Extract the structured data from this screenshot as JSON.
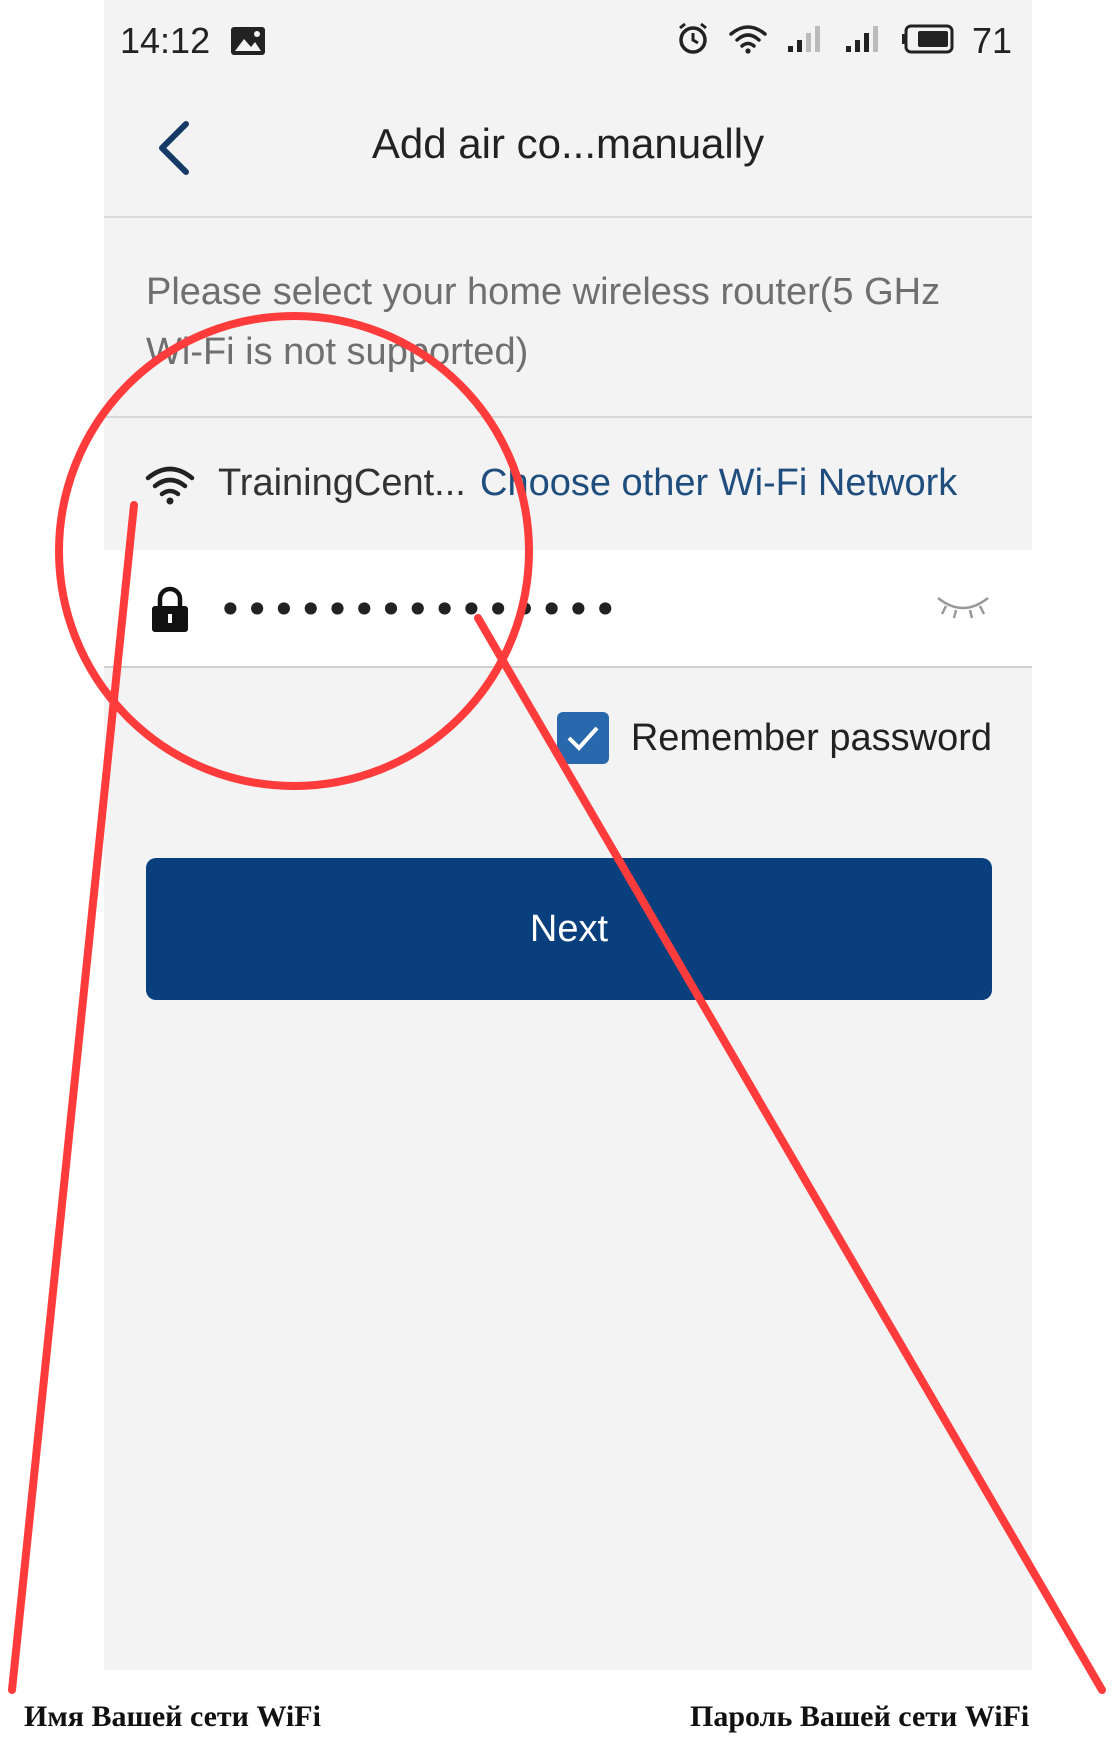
{
  "status_bar": {
    "time": "14:12",
    "battery": "71",
    "icons": [
      "image-icon",
      "alarm-icon",
      "wifi-icon",
      "signal-icon",
      "signal-icon",
      "battery-icon"
    ]
  },
  "header": {
    "back_icon": "chevron-left-icon",
    "title": "Add air co...manually"
  },
  "instruction": "Please select your home wireless router(5 GHz Wi-Fi is not supported)",
  "wifi": {
    "icon": "wifi-icon",
    "ssid": "TrainingCent...",
    "choose_label": "Choose other Wi-Fi Network"
  },
  "password": {
    "icon": "lock-icon",
    "value": "•••••••••••••••",
    "toggle_icon": "eye-closed-icon"
  },
  "remember": {
    "checked": true,
    "label": "Remember password"
  },
  "next_button": "Next",
  "annotations": {
    "wifi_name_caption": "Имя Вашей сети WiFi",
    "wifi_password_caption": "Пароль Вашей сети WiFi",
    "color": "#ff3b3b"
  },
  "colors": {
    "primary": "#0a3f7e",
    "link": "#1f4e7e",
    "checkbox": "#2a68ad",
    "background": "#f3f3f3"
  }
}
